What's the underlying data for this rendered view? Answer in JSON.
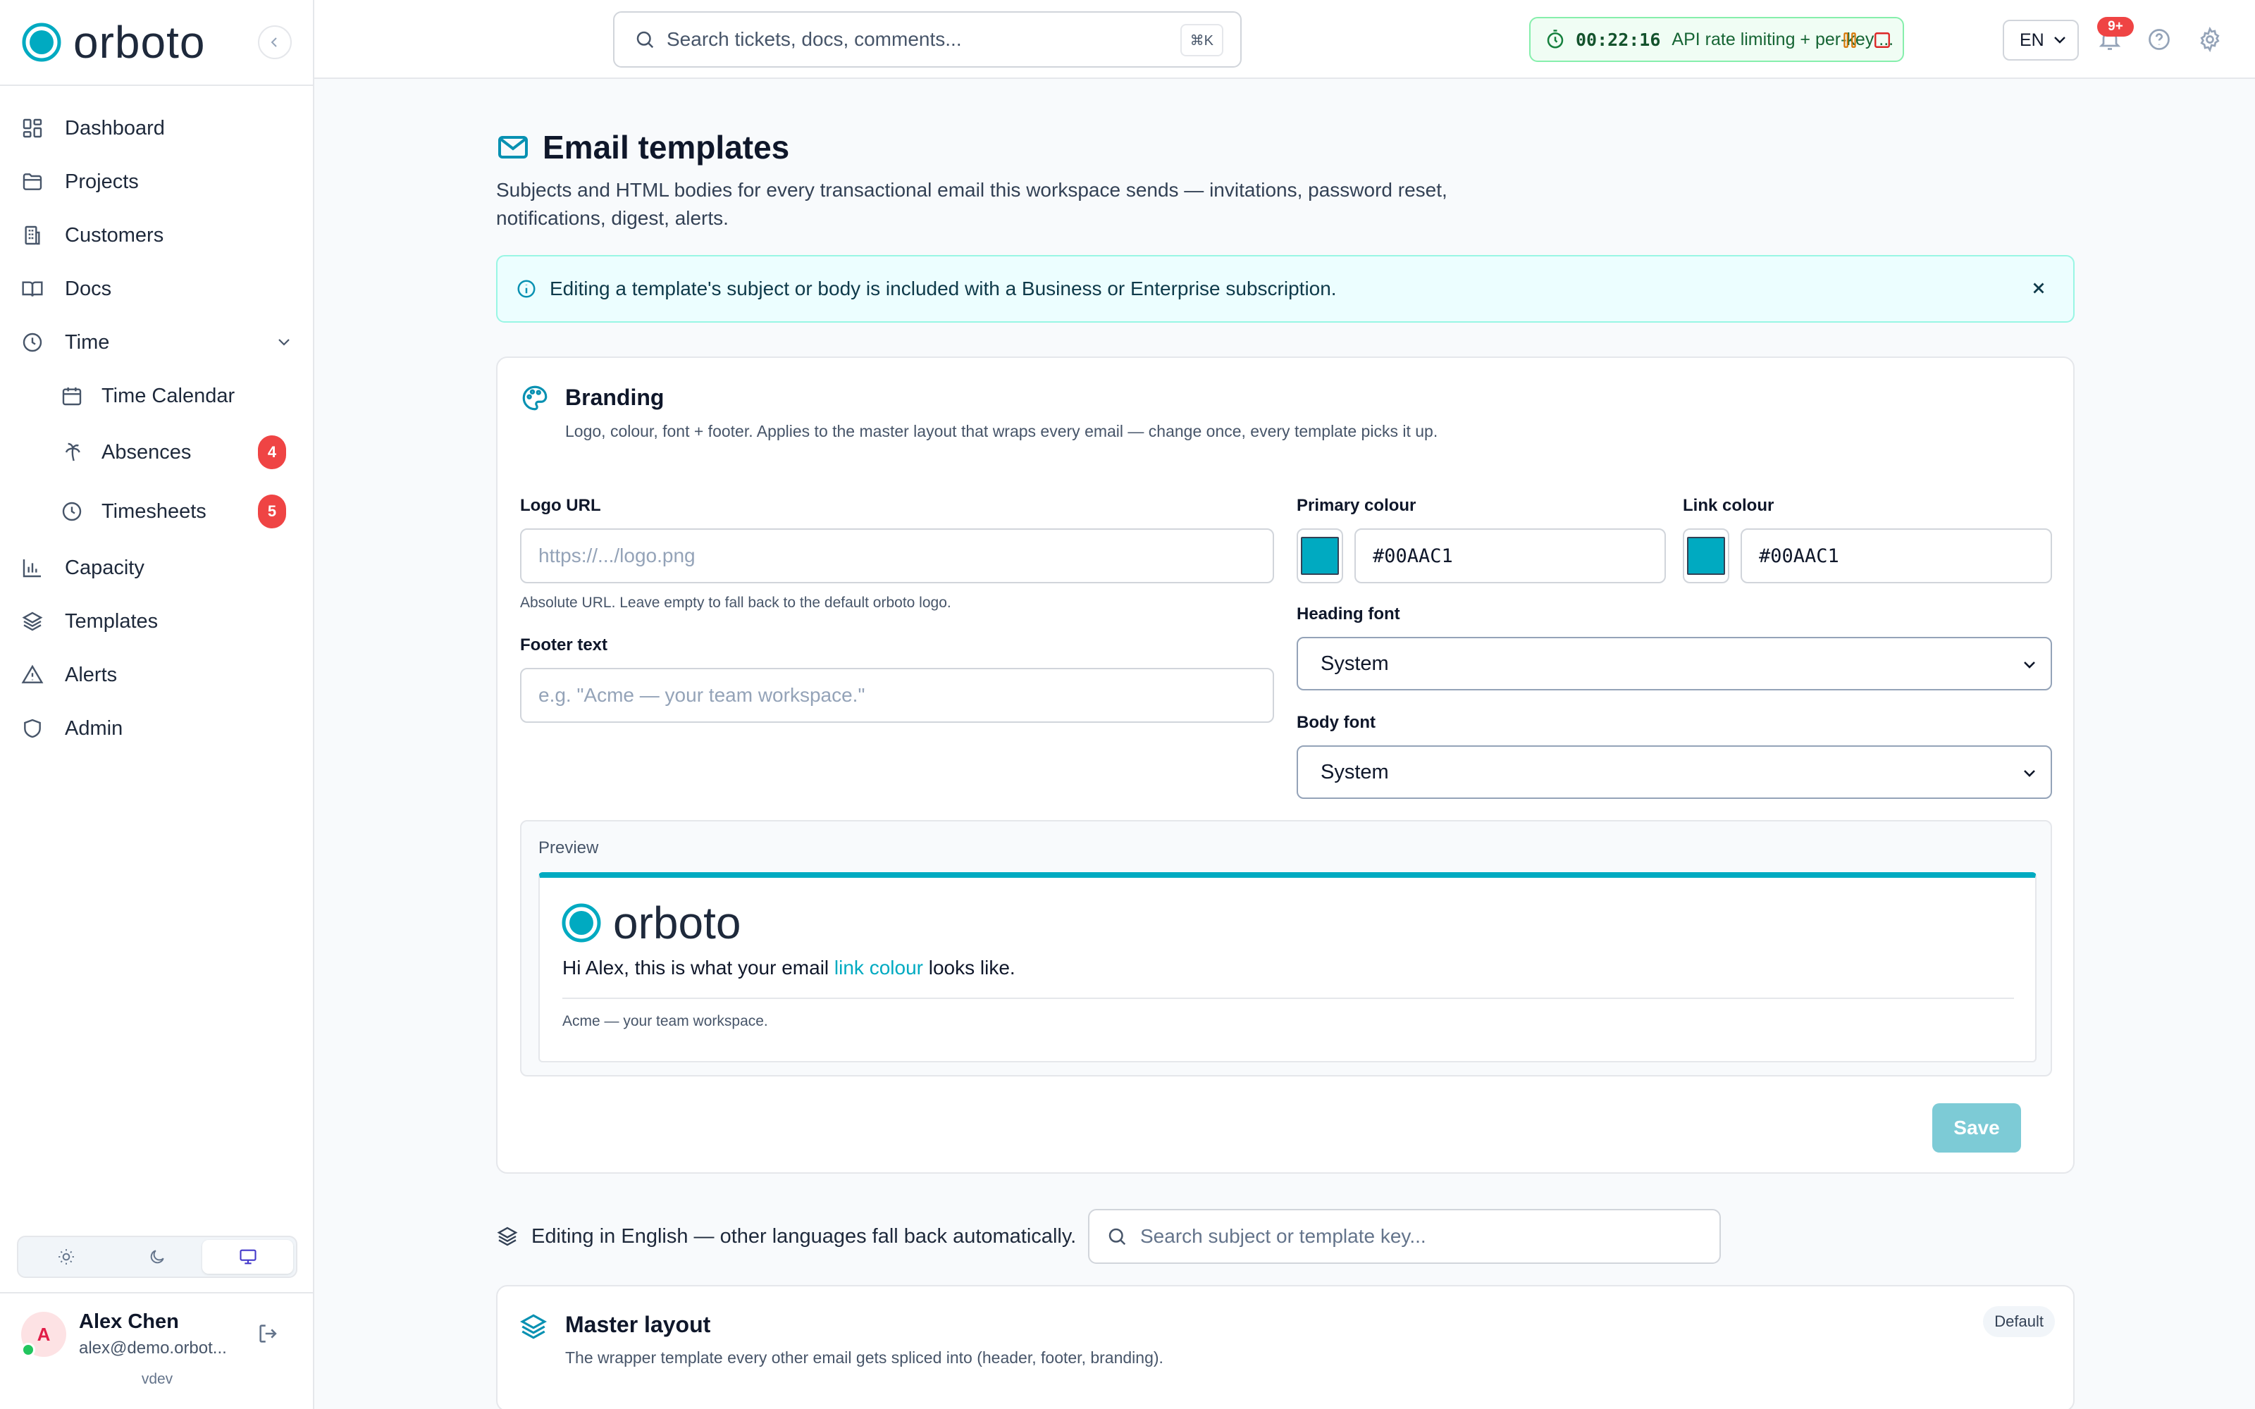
{
  "app": {
    "name": "orboto",
    "version": "vdev",
    "accent": "#00AAC1"
  },
  "sidebar": {
    "items": [
      {
        "label": "Dashboard",
        "icon": "dashboard-icon"
      },
      {
        "label": "Projects",
        "icon": "folder-icon"
      },
      {
        "label": "Customers",
        "icon": "building-icon"
      },
      {
        "label": "Docs",
        "icon": "book-icon"
      },
      {
        "label": "Time",
        "icon": "clock-icon",
        "expanded": true
      },
      {
        "label": "Time Calendar",
        "icon": "calendar-icon"
      },
      {
        "label": "Absences",
        "icon": "palm-tree-icon",
        "badge": "4"
      },
      {
        "label": "Timesheets",
        "icon": "clock-icon",
        "badge": "5"
      },
      {
        "label": "Capacity",
        "icon": "bar-chart-icon"
      },
      {
        "label": "Templates",
        "icon": "layers-icon"
      },
      {
        "label": "Alerts",
        "icon": "warning-icon"
      },
      {
        "label": "Admin",
        "icon": "shield-icon"
      }
    ],
    "theme_active": "system"
  },
  "user": {
    "initial": "A",
    "name": "Alex Chen",
    "email": "alex@demo.orbot..."
  },
  "topbar": {
    "search_placeholder": "Search tickets, docs, comments...",
    "search_shortcut": "⌘K",
    "timer_time": "00:22:16",
    "timer_task": "API rate limiting + per-key ...",
    "language": "EN",
    "notifications_badge": "9+"
  },
  "page": {
    "title": "Email templates",
    "description": "Subjects and HTML bodies for every transactional email this workspace sends — invitations, password reset, notifications, digest, alerts.",
    "info_banner": "Editing a template's subject or body is included with a Business or Enterprise subscription."
  },
  "branding": {
    "title": "Branding",
    "description": "Logo, colour, font + footer. Applies to the master layout that wraps every email — change once, every template picks it up.",
    "logo_url_label": "Logo URL",
    "logo_url_placeholder": "https://.../logo.png",
    "logo_url_help": "Absolute URL. Leave empty to fall back to the default orboto logo.",
    "footer_label": "Footer text",
    "footer_placeholder": "e.g. \"Acme — your team workspace.\"",
    "primary_colour_label": "Primary colour",
    "primary_colour": "#00AAC1",
    "link_colour_label": "Link colour",
    "link_colour": "#00AAC1",
    "heading_font_label": "Heading font",
    "heading_font": "System",
    "body_font_label": "Body font",
    "body_font": "System",
    "preview_label": "Preview",
    "preview_brand": "orboto",
    "preview_text_before": "Hi Alex, this is what your email ",
    "preview_link": "link colour",
    "preview_text_after": " looks like.",
    "preview_footer": "Acme — your team workspace.",
    "save_label": "Save"
  },
  "editing": {
    "language_note": "Editing in English — other languages fall back automatically.",
    "search_placeholder": "Search subject or template key..."
  },
  "master_layout": {
    "title": "Master layout",
    "description": "The wrapper template every other email gets spliced into (header, footer, branding).",
    "badge": "Default"
  }
}
